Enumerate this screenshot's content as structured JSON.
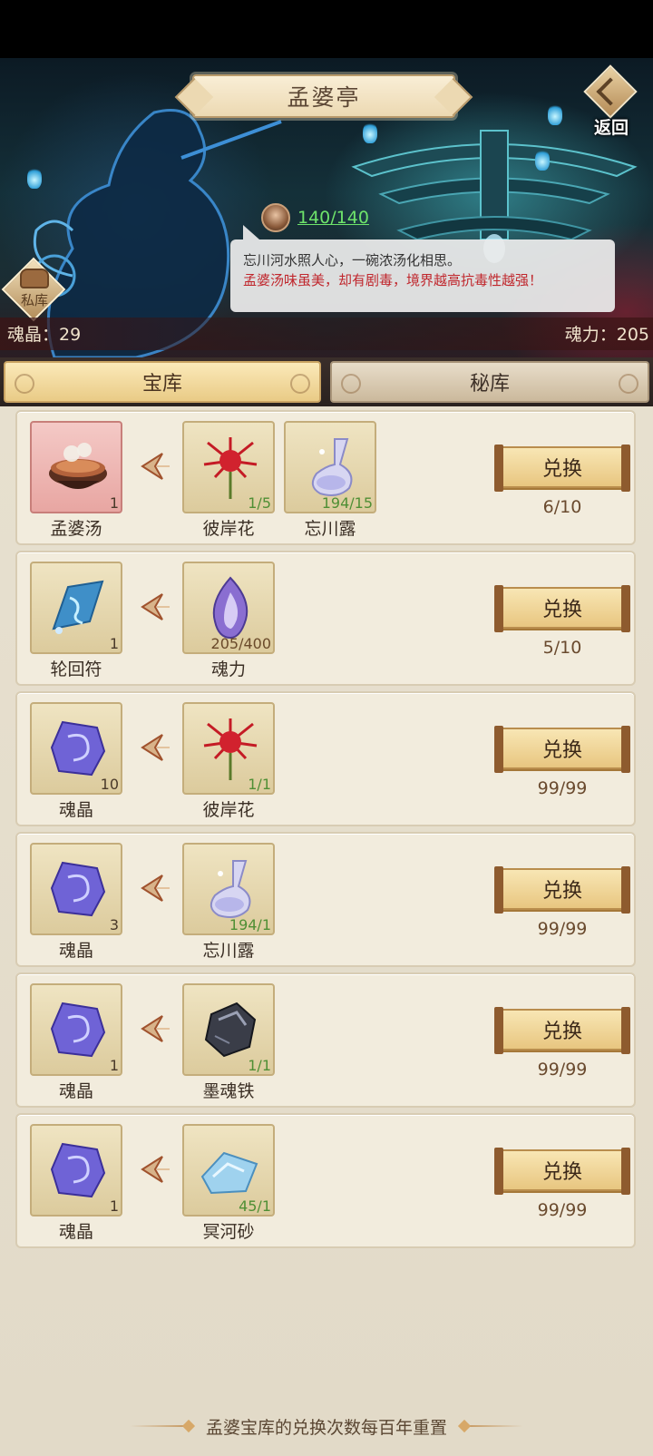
{
  "header": {
    "title": "孟婆亭",
    "back_label": "返回",
    "soup_counter": "140/140",
    "private_vault_label": "私库"
  },
  "speech": {
    "line1": "忘川河水照人心，一碗浓汤化相思。",
    "line2": "孟婆汤味虽美，却有剧毒，境界越高抗毒性越强！"
  },
  "resources": {
    "left_label": "魂晶：",
    "left_value": "29",
    "right_label": "魂力：",
    "right_value": "205"
  },
  "tabs": [
    {
      "label": "宝库",
      "active": true
    },
    {
      "label": "秘库",
      "active": false
    }
  ],
  "exchanges": [
    {
      "reward": {
        "name": "孟婆汤",
        "count": "1",
        "icon": "soup-bowl-icon"
      },
      "costs": [
        {
          "name": "彼岸花",
          "count": "1/5",
          "icon": "red-spider-lily-icon"
        },
        {
          "name": "忘川露",
          "count": "194/15",
          "icon": "dew-flask-icon"
        }
      ],
      "button": "兑换",
      "limit": "6/10"
    },
    {
      "reward": {
        "name": "轮回符",
        "count": "1",
        "icon": "talisman-icon"
      },
      "costs": [
        {
          "name": "魂力",
          "count": "205/400",
          "icon": "soul-flame-icon"
        }
      ],
      "button": "兑换",
      "limit": "5/10"
    },
    {
      "reward": {
        "name": "魂晶",
        "count": "10",
        "icon": "soul-crystal-icon"
      },
      "costs": [
        {
          "name": "彼岸花",
          "count": "1/1",
          "icon": "red-spider-lily-icon"
        }
      ],
      "button": "兑换",
      "limit": "99/99"
    },
    {
      "reward": {
        "name": "魂晶",
        "count": "3",
        "icon": "soul-crystal-icon"
      },
      "costs": [
        {
          "name": "忘川露",
          "count": "194/1",
          "icon": "dew-flask-icon"
        }
      ],
      "button": "兑换",
      "limit": "99/99"
    },
    {
      "reward": {
        "name": "魂晶",
        "count": "1",
        "icon": "soul-crystal-icon"
      },
      "costs": [
        {
          "name": "墨魂铁",
          "count": "1/1",
          "icon": "black-iron-ore-icon"
        }
      ],
      "button": "兑换",
      "limit": "99/99"
    },
    {
      "reward": {
        "name": "魂晶",
        "count": "1",
        "icon": "soul-crystal-icon"
      },
      "costs": [
        {
          "name": "冥河砂",
          "count": "45/1",
          "icon": "blue-sand-icon"
        }
      ],
      "button": "兑换",
      "limit": "99/99"
    }
  ],
  "footer": {
    "text": "孟婆宝库的兑换次数每百年重置"
  },
  "colors": {
    "counter_green": "#6ee36b",
    "warning_red": "#c0272d",
    "tab_active": "#e9cb86",
    "button_gold": "#e8c680"
  }
}
